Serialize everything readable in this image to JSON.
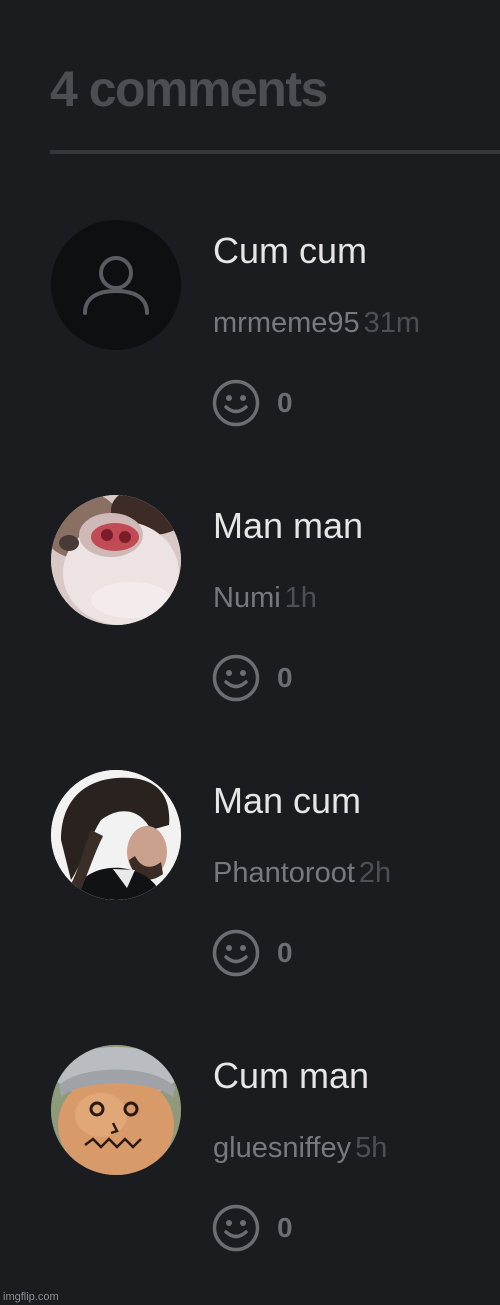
{
  "header": {
    "title": "4 comments"
  },
  "comments": [
    {
      "text": "Cum cum",
      "username": "mrmeme95",
      "time": "31m",
      "reaction_count": "0",
      "avatar": "default-user-icon"
    },
    {
      "text": "Man man",
      "username": "Numi",
      "time": "1h",
      "reaction_count": "0",
      "avatar": "animal-photo"
    },
    {
      "text": "Man cum",
      "username": "Phantoroot",
      "time": "2h",
      "reaction_count": "0",
      "avatar": "person-photo"
    },
    {
      "text": "Cum man",
      "username": "gluesniffey",
      "time": "5h",
      "reaction_count": "0",
      "avatar": "drawn-face-photo"
    }
  ],
  "watermark": "imgflip.com",
  "colors": {
    "background": "#1b1c20",
    "heading": "#4c4e54",
    "comment_text": "#e6e6e6",
    "username": "#77797f",
    "timestamp": "#4d4f55"
  }
}
